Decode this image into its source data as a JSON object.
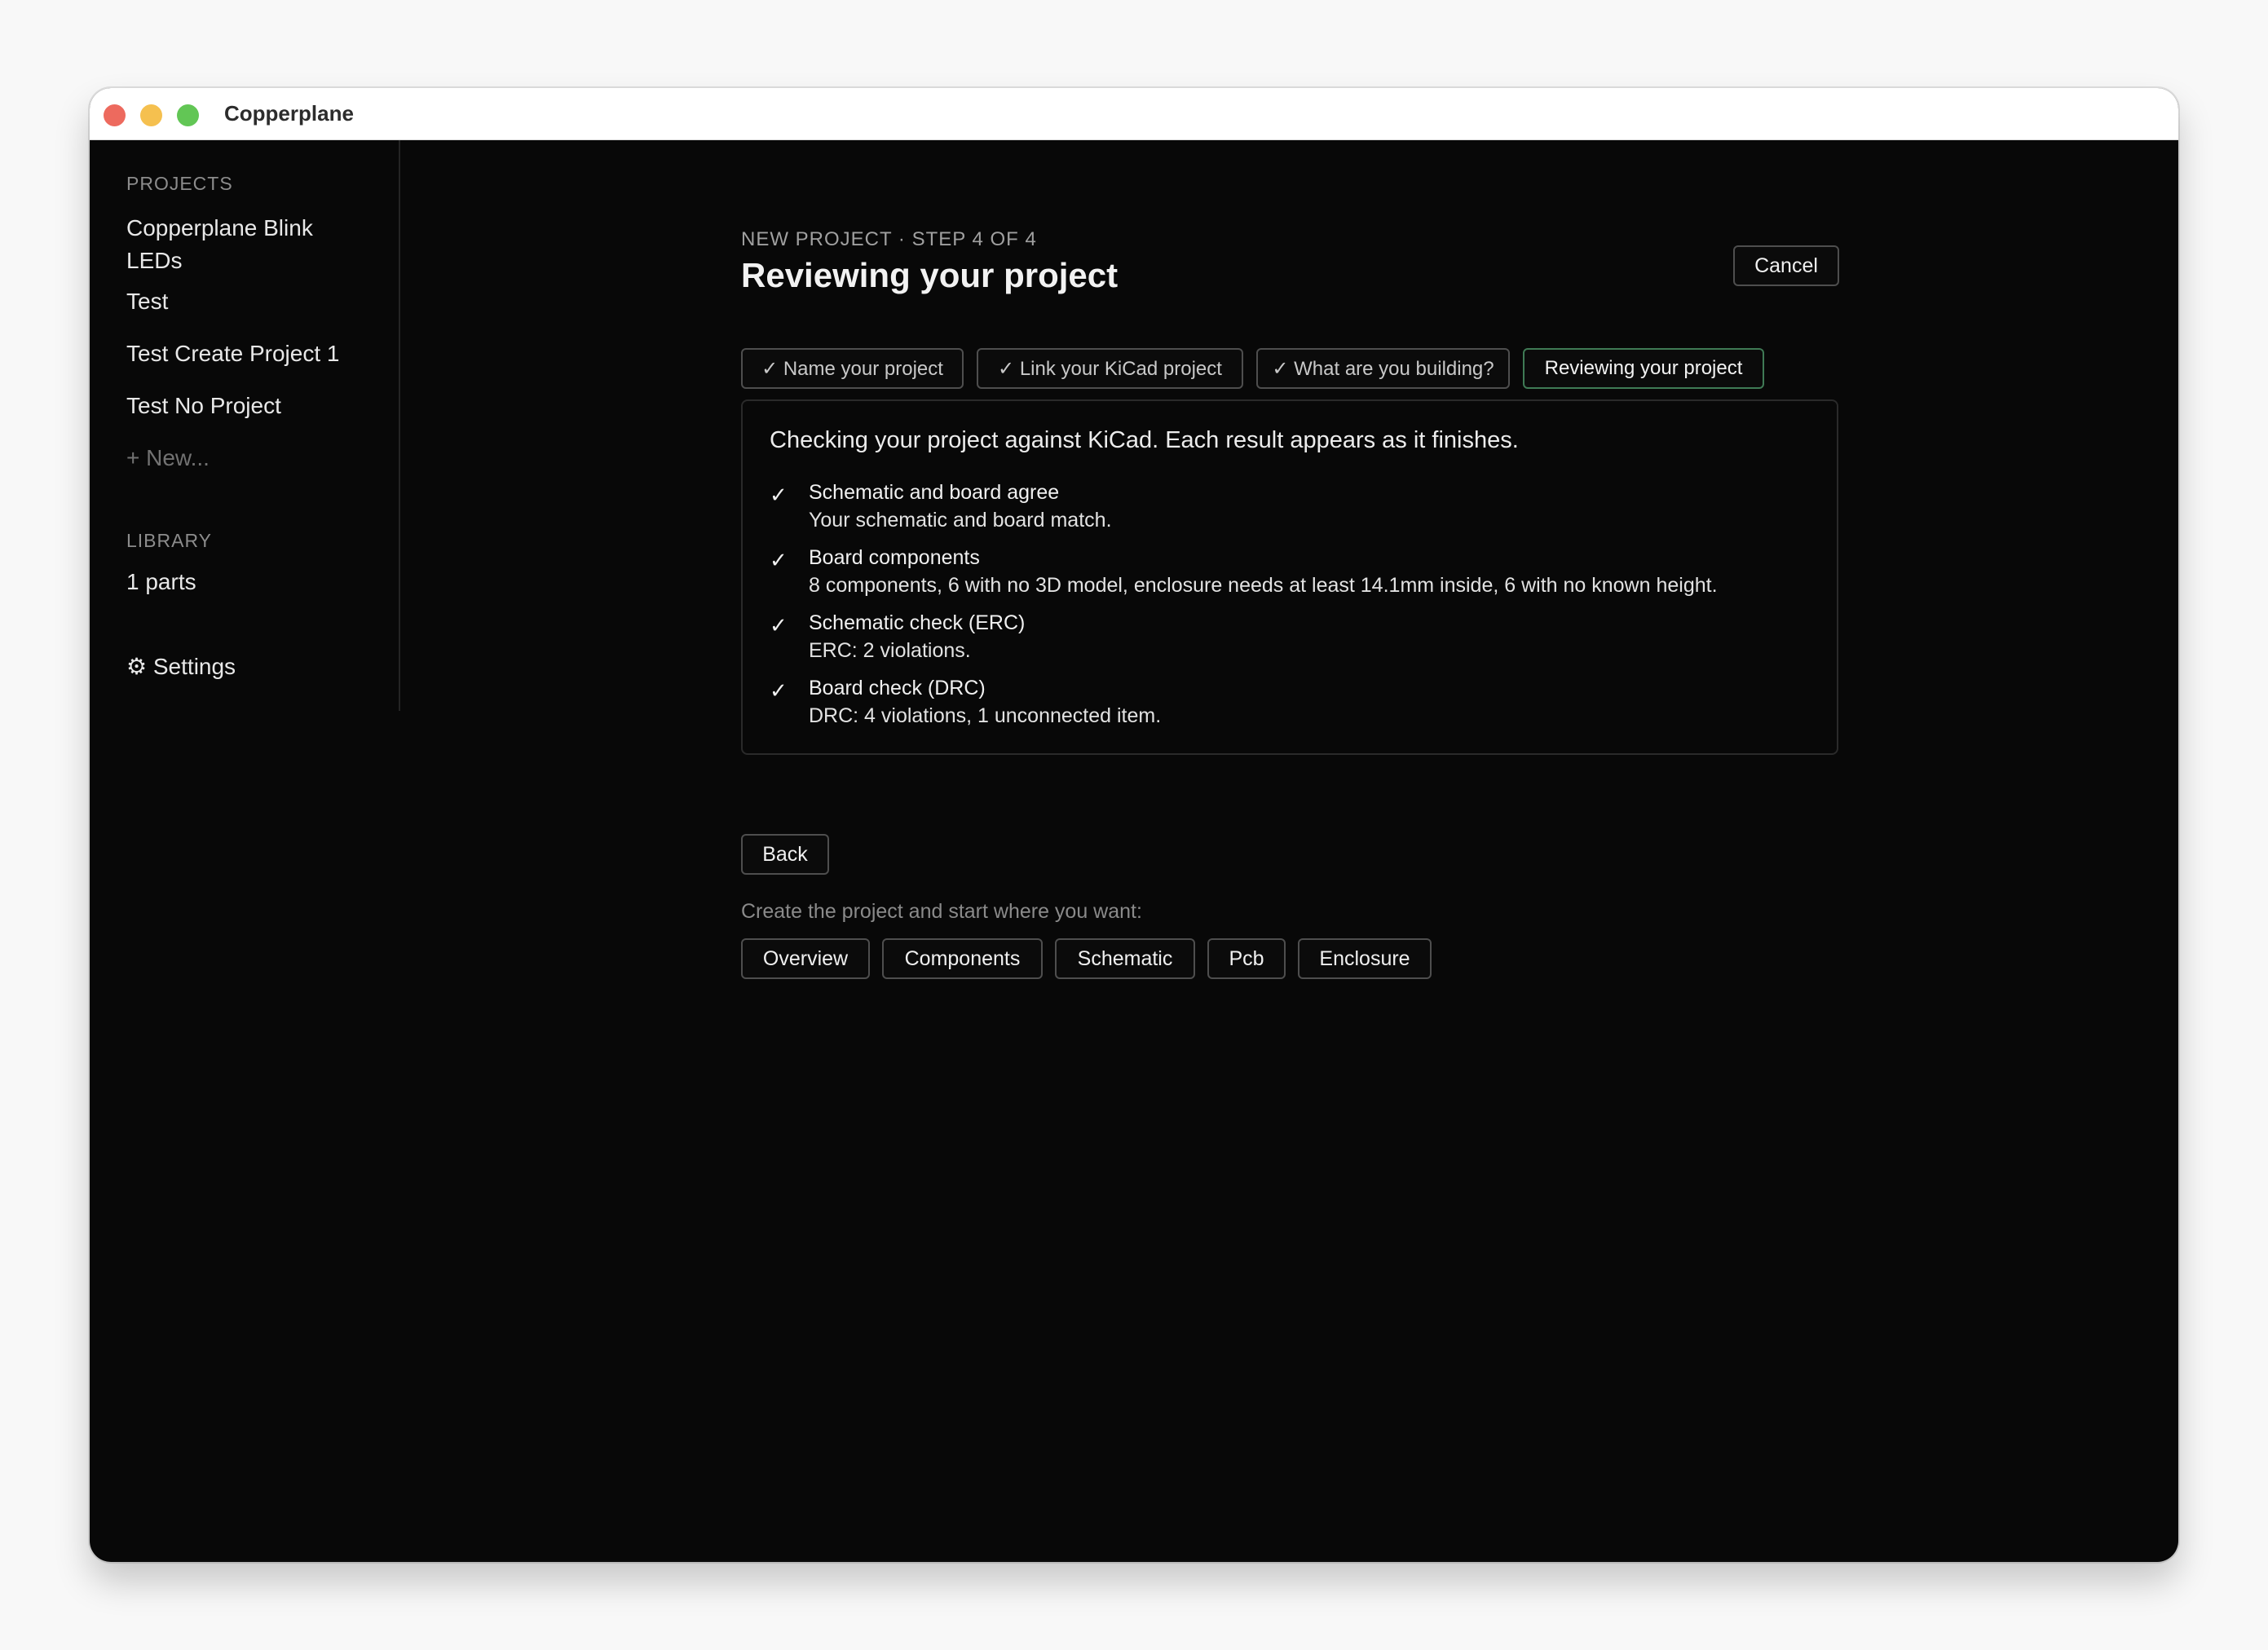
{
  "window": {
    "title": "Copperplane"
  },
  "sidebar": {
    "projects_heading": "PROJECTS",
    "projects": [
      "Copperplane Blink LEDs",
      "Test",
      "Test Create Project 1",
      "Test No Project"
    ],
    "new_label": "+ New...",
    "library_heading": "LIBRARY",
    "library_item": "1 parts",
    "settings_label": "⚙ Settings"
  },
  "header": {
    "step_label": "NEW PROJECT · STEP 4 OF 4",
    "title": "Reviewing your project",
    "cancel_label": "Cancel"
  },
  "steps": [
    {
      "label": "✓ Name your project",
      "state": "done"
    },
    {
      "label": "✓ Link your KiCad project",
      "state": "done"
    },
    {
      "label": "✓ What are you building?",
      "state": "done"
    },
    {
      "label": "Reviewing your project",
      "state": "active"
    }
  ],
  "review": {
    "intro": "Checking your project against KiCad. Each result appears as it finishes.",
    "checks": [
      {
        "mark": "✓",
        "title": "Schematic and board agree",
        "detail": "Your schematic and board match."
      },
      {
        "mark": "✓",
        "title": "Board components",
        "detail": "8 components, 6 with no 3D model, enclosure needs at least 14.1mm inside, 6 with no known height."
      },
      {
        "mark": "✓",
        "title": "Schematic check (ERC)",
        "detail": "ERC: 2 violations."
      },
      {
        "mark": "✓",
        "title": "Board check (DRC)",
        "detail": "DRC: 4 violations, 1 unconnected item."
      }
    ]
  },
  "actions": {
    "back_label": "Back",
    "start_label": "Create the project and start where you want:",
    "start_options": [
      "Overview",
      "Components",
      "Schematic",
      "Pcb",
      "Enclosure"
    ]
  },
  "colors": {
    "background": "#080808",
    "active_step_border": "#3f7a55",
    "traffic_close": "#ed6a5e",
    "traffic_minimize": "#f5c04f",
    "traffic_maximize": "#62c655"
  }
}
